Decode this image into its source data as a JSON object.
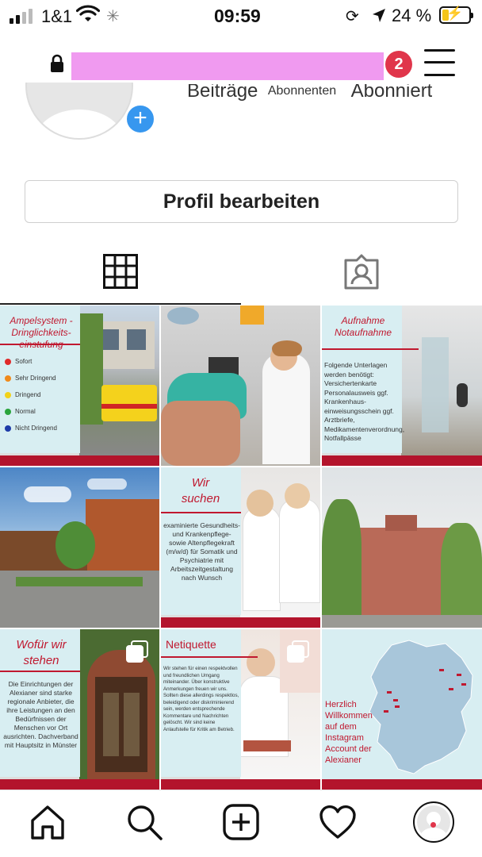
{
  "status_bar": {
    "carrier": "1&1",
    "time": "09:59",
    "battery_percent": "24 %",
    "battery_level": 0.24
  },
  "header": {
    "notification_count": "2"
  },
  "profile": {
    "stats_labels": [
      "Beiträge",
      "Abonnenten",
      "Abonniert"
    ],
    "edit_button": "Profil bearbeiten"
  },
  "posts": [
    {
      "title": "Ampelsystem - Dringlichkeits-einstufung",
      "legend": [
        {
          "label": "Sofort",
          "color": "#e02a2a"
        },
        {
          "label": "Sehr Dringend",
          "color": "#f08a1c"
        },
        {
          "label": "Dringend",
          "color": "#f2d21a"
        },
        {
          "label": "Normal",
          "color": "#2aa43c"
        },
        {
          "label": "Nicht Dringend",
          "color": "#1e3aa8"
        }
      ]
    },
    {
      "title": ""
    },
    {
      "title": "Aufnahme Notaufnahme",
      "text": "Folgende Unterlagen werden benötigt: Versichertenkarte Personalausweis ggf. Krankenhaus-einweisungsschein ggf. Arztbriefe, Medikamentenverordnung, Notfallpässe"
    },
    {
      "title": ""
    },
    {
      "title": "Wir suchen",
      "text": "examinierte Gesundheits- und Krankenpflege- sowie Altenpflegekraft (m/w/d) für Somatik und Psychiatrie mit Arbeitszeitgestaltung nach Wunsch"
    },
    {
      "title": ""
    },
    {
      "title": "Wofür wir stehen",
      "text": "Die Einrichtungen der Alexianer sind starke regionale Anbieter, die ihre Leistungen an den Bedürfnissen der Menschen vor Ort ausrichten. Dachverband mit Hauptsitz in Münster"
    },
    {
      "title": "Netiquette",
      "text": "Wir stehen für einen respektvollen und freundlichen Umgang miteinander. Über konstruktive Anmerkungen freuen wir uns. Sollten diese allerdings respektlos, beleidigend oder diskriminierend sein, werden entsprechende Kommentare und Nachrichten gelöscht. Wir sind keine Anlaufstelle für Kritik am Betrieb."
    },
    {
      "title": "Herzlich Willkommen auf dem Instagram Account der Alexianer"
    }
  ],
  "icons": {
    "nav": [
      "home-icon",
      "search-icon",
      "new-post-icon",
      "activity-heart-icon",
      "profile-avatar-icon"
    ]
  },
  "colors": {
    "accent_red": "#b3142c",
    "badge_red": "#e0364b",
    "story_blue": "#3797ef",
    "redacted_pink": "#f09af0"
  }
}
